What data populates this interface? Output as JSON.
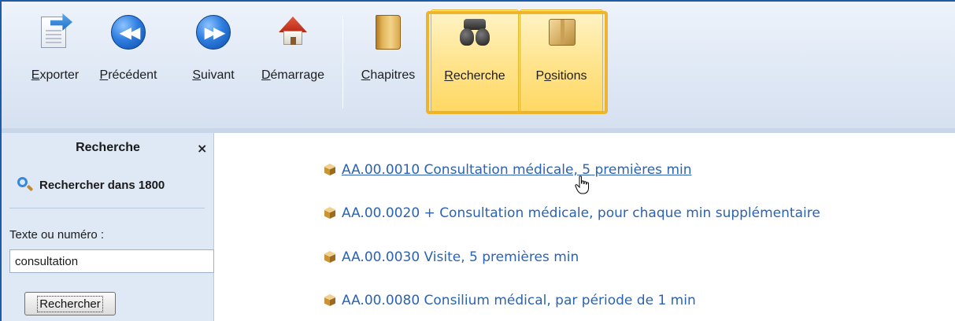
{
  "toolbar": {
    "buttons": [
      {
        "label": "Exporter",
        "mnemonic": "E",
        "rest": "xporter",
        "icon": "export-icon"
      },
      {
        "label": "Précédent",
        "mnemonic": "P",
        "rest": "récédent",
        "icon": "previous-icon"
      },
      {
        "label": "Suivant",
        "mnemonic": "S",
        "rest": "uivant",
        "icon": "next-icon"
      },
      {
        "label": "Démarrage",
        "mnemonic": "D",
        "rest": "émarrage",
        "icon": "home-icon"
      },
      {
        "label": "Chapitres",
        "mnemonic": "C",
        "rest": "hapitres",
        "icon": "book-icon"
      },
      {
        "label": "Recherche",
        "mnemonic": "R",
        "rest": "echerche",
        "icon": "binoculars-icon",
        "active": true
      },
      {
        "label": "Positions",
        "pre": "P",
        "mnemonic": "o",
        "rest": "sitions",
        "icon": "box-icon",
        "active": true
      }
    ],
    "highlight_color": "#f0b429"
  },
  "search_panel": {
    "title": "Recherche",
    "close_glyph": "×",
    "search_scope": "Rechercher dans 1800",
    "field_label": "Texte ou numéro :",
    "field_value": "consultation",
    "button_label": "Rechercher"
  },
  "results": [
    {
      "text": " AA.00.0010 Consultation médicale, 5 premières min"
    },
    {
      "text": "AA.00.0020 + Consultation médicale, pour chaque min supplémentaire"
    },
    {
      "text": "AA.00.0030 Visite, 5 premières min"
    },
    {
      "text": "AA.00.0080 Consilium médical, par période de 1 min"
    }
  ],
  "colors": {
    "link": "#2b63b2",
    "accent": "#1f5aa8",
    "panel_bg": "#dfe8f5"
  }
}
